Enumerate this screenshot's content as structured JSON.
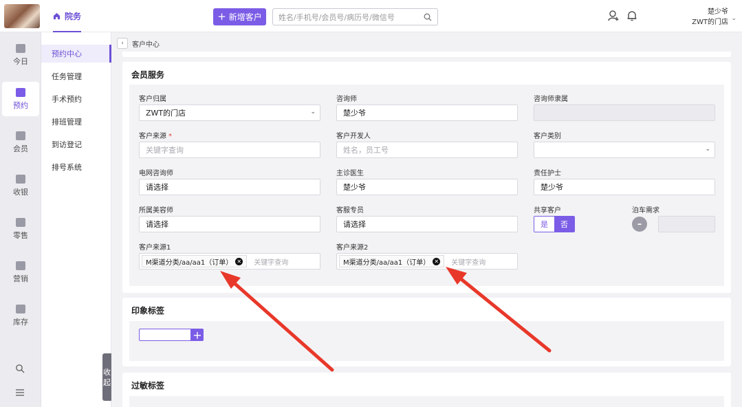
{
  "topbar": {
    "nav_tab": "院务",
    "new_customer": "新增客户",
    "search_placeholder": "姓名/手机号/会员号/病历号/微信号",
    "user_name": "楚少爷",
    "store_name": "ZWT的门店"
  },
  "rail": {
    "items": [
      {
        "label": "今日",
        "icon": "calendar-today-icon"
      },
      {
        "label": "预约",
        "icon": "appointment-icon"
      },
      {
        "label": "会员",
        "icon": "member-icon"
      },
      {
        "label": "收银",
        "icon": "cashier-icon"
      },
      {
        "label": "零售",
        "icon": "retail-bag-icon"
      },
      {
        "label": "营销",
        "icon": "marketing-icon"
      },
      {
        "label": "库存",
        "icon": "inventory-box-icon"
      }
    ]
  },
  "subnav": {
    "items": [
      "预约中心",
      "任务管理",
      "手术预约",
      "排班管理",
      "到访登记",
      "排号系统"
    ],
    "collapse": [
      "收",
      "起"
    ]
  },
  "breadcrumb": "客户中心",
  "member_service": {
    "title": "会员服务",
    "customer_owner_label": "客户归属",
    "customer_owner_value": "ZWT的门店",
    "consultant_label": "咨询师",
    "consultant_value": "楚少爷",
    "consultant_dept_label": "咨询师隶属",
    "source_label": "客户来源",
    "source_placeholder": "关键字查询",
    "developer_label": "客户开发人",
    "developer_placeholder": "姓名，员工号",
    "category_label": "客户类别",
    "online_consultant_label": "电网咨询师",
    "online_consultant_value": "请选择",
    "doctor_label": "主诊医生",
    "doctor_value": "楚少爷",
    "nurse_label": "责任护士",
    "nurse_value": "楚少爷",
    "beautician_label": "所属美容师",
    "beautician_value": "请选择",
    "cs_label": "客服专员",
    "cs_value": "请选择",
    "shared_label": "共享客户",
    "shared_yes": "是",
    "shared_no": "否",
    "parking_label": "泊车需求",
    "parking_toggle": "–",
    "source1_label": "客户来源1",
    "source1_tag": "M渠道分类/aa/aa1（订单）",
    "source1_placeholder": "关键字查询",
    "source2_label": "客户来源2",
    "source2_tag": "M渠道分类/aa/aa1（订单）",
    "source2_placeholder": "关键字查询"
  },
  "impression": {
    "title": "印象标签",
    "add": "+"
  },
  "allergy": {
    "title": "过敏标签"
  },
  "colors": {
    "accent": "#7b5ce6",
    "annotation_arrow": "#e8382a"
  }
}
